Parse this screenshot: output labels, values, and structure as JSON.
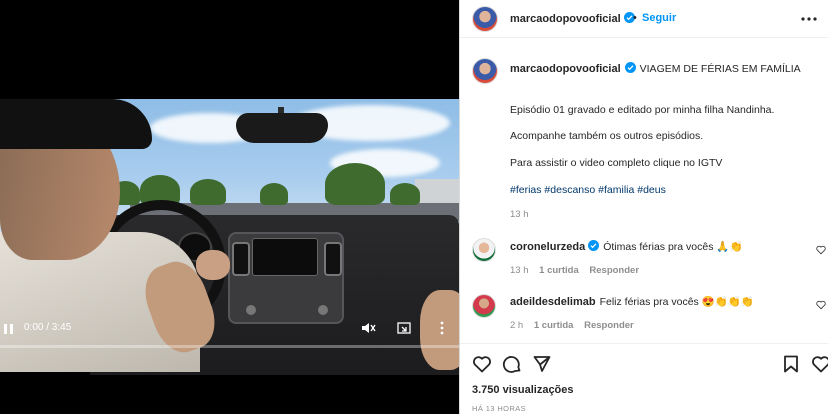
{
  "video": {
    "time_display": "0:00 / 3:45",
    "progress": 0.0,
    "is_paused": true
  },
  "post": {
    "author": {
      "username": "marcaodopovooficial",
      "verified": true
    },
    "follow_separator": "•",
    "follow_label": "Seguir",
    "caption": {
      "title": "VIAGEM DE FÉRIAS EM FAMÍLIA",
      "lines": [
        "Episódio 01 gravado e editado por minha filha Nandinha.",
        "Acompanhe também os outros episódios.",
        "Para assistir o video completo clique no IGTV"
      ],
      "hashtags": "#ferias #descanso #familia #deus",
      "age": "13 h"
    },
    "comments": [
      {
        "username": "coronelurzeda",
        "verified": true,
        "text": "Ótimas férias pra vocês 🙏👏",
        "age": "13 h",
        "likes": "1 curtida",
        "reply": "Responder"
      },
      {
        "username": "adeildesdelimab",
        "verified": false,
        "text": "Feliz férias pra vocês 😍👏👏👏",
        "age": "2 h",
        "likes": "1 curtida",
        "reply": "Responder"
      }
    ],
    "views": "3.750 visualizações",
    "time_ago": "HÁ 13 HORAS"
  },
  "icons": {
    "play": "pause-icon",
    "mute": "speaker-muted-icon",
    "pip": "picture-in-picture-icon",
    "more": "more-icon",
    "like": "heart-icon",
    "comment": "comment-icon",
    "share": "send-icon",
    "save": "bookmark-icon"
  },
  "colors": {
    "link_blue": "#0095f6",
    "hashtag": "#00376b",
    "muted_text": "#8e8e8e",
    "verified": "#0095f6"
  }
}
